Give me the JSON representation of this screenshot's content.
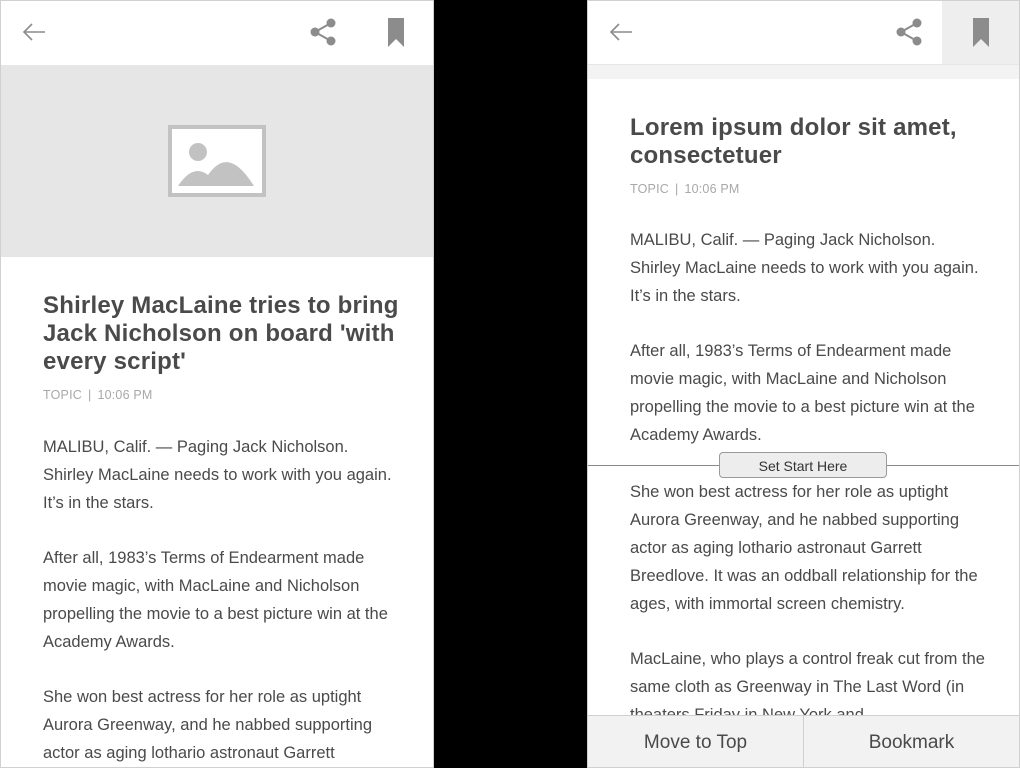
{
  "left": {
    "title": "Shirley MacLaine tries to bring Jack Nicholson on board 'with every script'",
    "topic": "TOPIC",
    "separator": "|",
    "time": "10:06 PM",
    "paragraphs": [
      "MALIBU, Calif. — Paging Jack Nicholson. Shirley MacLaine needs to work with you again. It’s in the stars.",
      "After all, 1983’s Terms of Endearment made movie magic, with MacLaine and Nicholson propelling the movie to a best picture win at the Academy Awards.",
      "She won best actress for her role as uptight Aurora Greenway, and he nabbed supporting actor as aging lothario astronaut Garrett"
    ]
  },
  "right": {
    "title": "Lorem ipsum dolor sit amet, consectetuer",
    "topic": "TOPIC",
    "separator": "|",
    "time": "10:06 PM",
    "paragraphs_before": [
      "MALIBU, Calif. — Paging Jack Nicholson. Shirley MacLaine needs to work with you again. It’s in the stars.",
      "After all, 1983’s Terms of Endearment made movie magic, with MacLaine and Nicholson propelling the movie to a best picture win at the Academy Awards."
    ],
    "set_start_label": "Set Start Here",
    "paragraphs_after": [
      "She won best actress for her role as uptight Aurora Greenway, and he nabbed supporting actor as aging lothario astronaut Garrett Breedlove. It was an oddball relationship for the ages, with immortal screen chemistry.",
      "MacLaine, who plays a control freak cut from the same cloth as Greenway in The Last Word (in theaters Friday in New York and"
    ],
    "bottom": {
      "move_top": "Move to Top",
      "bookmark": "Bookmark"
    }
  },
  "colors": {
    "icon": "#8c8c8c",
    "text": "#4a4a4a",
    "meta": "#a8a8a8",
    "placeholder": "#e6e6e6"
  },
  "icons": [
    "back-arrow-icon",
    "share-icon",
    "bookmark-icon",
    "image-placeholder-icon"
  ]
}
